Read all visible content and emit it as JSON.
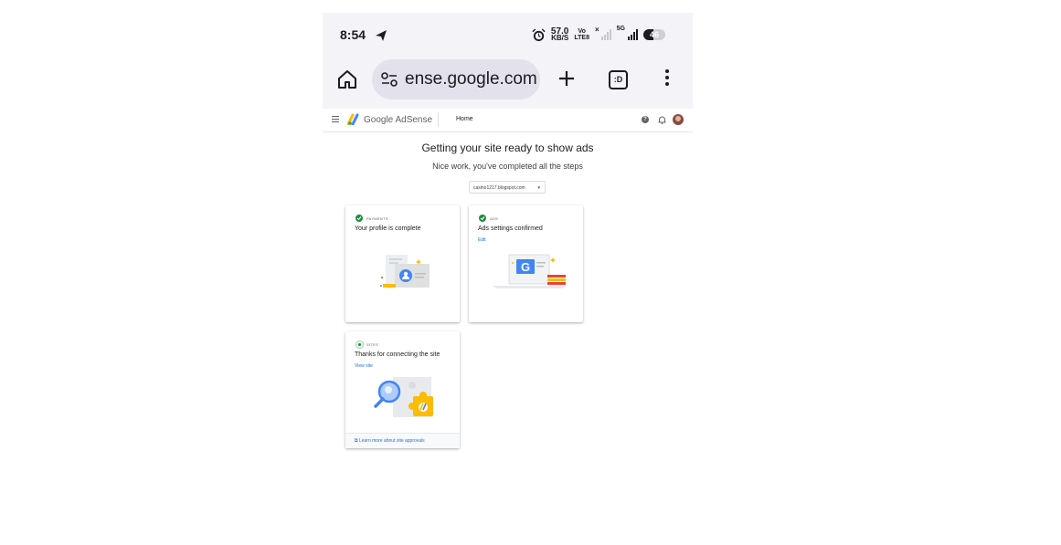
{
  "status_bar": {
    "time": "8:54",
    "speed_value": "57.0",
    "speed_unit": "KB/S",
    "volte_top": "Vo",
    "volte_bottom": "LTE8",
    "network_5g": "5G",
    "battery": "46",
    "battery_level": 0.46
  },
  "browser": {
    "url": "ense.google.com"
  },
  "adsense_header": {
    "brand": "Google AdSense",
    "nav_home": "Home",
    "help_glyph": "?"
  },
  "page": {
    "title": "Getting your site ready to show ads",
    "subtitle": "Nice work, you've completed all the steps",
    "site_selector": "casino1217.blogspot.com"
  },
  "cards": {
    "payments": {
      "eyebrow": "PAYMENTS",
      "title": "Your profile is complete"
    },
    "ads": {
      "eyebrow": "ADS",
      "title": "Ads settings confirmed",
      "link": "Edit"
    },
    "sites": {
      "eyebrow": "SITES",
      "title": "Thanks for connecting the site",
      "link": "View site",
      "footer_link": "Learn more about site approvals"
    }
  },
  "colors": {
    "accent": "#1a73e8",
    "success": "#1e8e3e",
    "chrome_bg": "#f4f3f8",
    "url_pill_bg": "#e3e2ec"
  }
}
